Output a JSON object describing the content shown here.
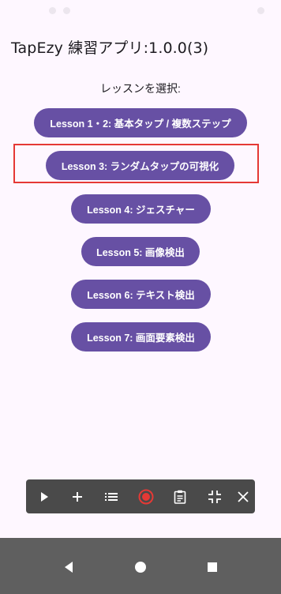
{
  "app": {
    "title": "TapEzy 練習アプリ:1.0.0(3)",
    "prompt": "レッスンを選択:"
  },
  "lessons": [
    {
      "label": "Lesson 1・2: 基本タップ / 複数ステップ"
    },
    {
      "label": "Lesson 3: ランダムタップの可視化",
      "highlighted": true
    },
    {
      "label": "Lesson 4: ジェスチャー"
    },
    {
      "label": "Lesson 5: 画像検出"
    },
    {
      "label": "Lesson 6: テキスト検出"
    },
    {
      "label": "Lesson 7: 画面要素検出"
    }
  ],
  "toolbar": {
    "icons": [
      "play-icon",
      "plus-icon",
      "list-icon",
      "record-icon",
      "clipboard-icon",
      "collapse-icon",
      "close-icon"
    ]
  },
  "navigation": {
    "icons": [
      "back-icon",
      "home-icon",
      "recents-icon"
    ]
  },
  "colors": {
    "background": "#fef7ff",
    "button": "#6750a4",
    "button_text": "#ffffff",
    "highlight": "#e53935",
    "toolbar": "#4a4a4a",
    "record": "#e53935",
    "nav_bar": "#5f5f5f"
  }
}
